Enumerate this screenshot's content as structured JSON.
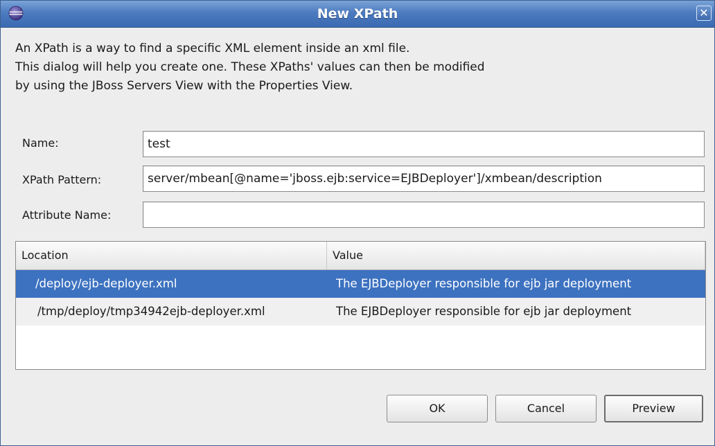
{
  "window": {
    "title": "New XPath",
    "close_glyph": "✕",
    "app_icon": "eclipse-icon",
    "close_icon": "close-icon"
  },
  "description": {
    "lines": [
      "An XPath is a way to find a specific XML element inside an xml file.",
      "This dialog will help you create one. These XPaths' values can then be modified",
      "by using the JBoss Servers View with the Properties View."
    ]
  },
  "form": {
    "name": {
      "label": "Name:",
      "value": "test"
    },
    "xpath_pattern": {
      "label": "XPath Pattern:",
      "value": "server/mbean[@name='jboss.ejb:service=EJBDeployer']/xmbean/description"
    },
    "attribute_name": {
      "label": "Attribute Name:",
      "value": ""
    }
  },
  "table": {
    "columns": [
      "Location",
      "Value"
    ],
    "rows": [
      {
        "location": "/deploy/ejb-deployer.xml",
        "value": "The EJBDeployer responsible for ejb jar deployment",
        "selected": true
      },
      {
        "location": "/tmp/deploy/tmp34942ejb-deployer.xml",
        "value": "The EJBDeployer responsible for ejb jar deployment",
        "selected": false
      }
    ]
  },
  "buttons": {
    "ok": "OK",
    "cancel": "Cancel",
    "preview": "Preview"
  },
  "colors": {
    "titlebar": "#4d7bc0",
    "selection": "#3d72c0",
    "dialog_bg": "#ededed"
  }
}
